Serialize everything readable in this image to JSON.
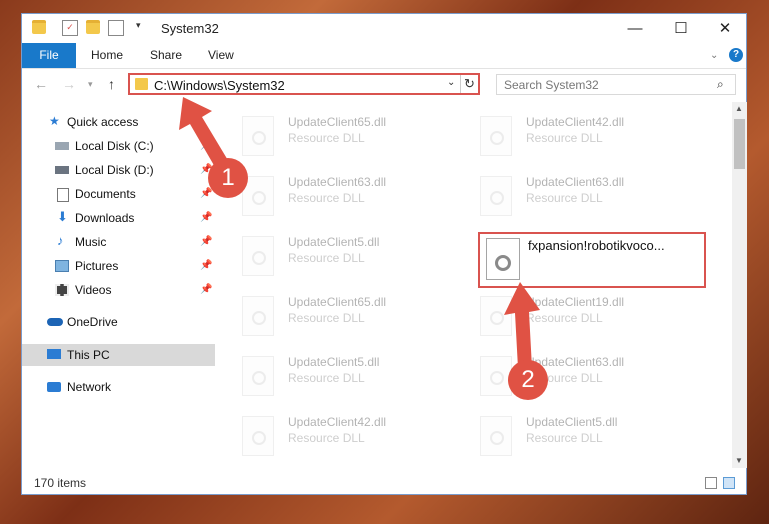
{
  "window": {
    "title": "System32"
  },
  "ribbon": {
    "file": "File",
    "tabs": [
      "Home",
      "Share",
      "View"
    ]
  },
  "address": {
    "path": "C:\\Windows\\System32",
    "search_placeholder": "Search System32"
  },
  "sidebar": {
    "items": [
      {
        "label": "Quick access",
        "icon": "star-icon"
      },
      {
        "label": "Local Disk (C:)",
        "icon": "drive-icon",
        "pinned": true
      },
      {
        "label": "Local Disk (D:)",
        "icon": "drive-icon",
        "pinned": true
      },
      {
        "label": "Documents",
        "icon": "documents-icon",
        "pinned": true
      },
      {
        "label": "Downloads",
        "icon": "downloads-icon",
        "pinned": true
      },
      {
        "label": "Music",
        "icon": "music-icon",
        "pinned": true
      },
      {
        "label": "Pictures",
        "icon": "pictures-icon",
        "pinned": true
      },
      {
        "label": "Videos",
        "icon": "videos-icon",
        "pinned": true
      },
      {
        "label": "OneDrive",
        "icon": "cloud-icon"
      },
      {
        "label": "This PC",
        "icon": "pc-icon",
        "selected": true
      },
      {
        "label": "Network",
        "icon": "network-icon"
      }
    ]
  },
  "files": [
    {
      "name": "UpdateClient65.dll",
      "type": "Resource DLL"
    },
    {
      "name": "UpdateClient42.dll",
      "type": "Resource DLL"
    },
    {
      "name": "UpdateClient63.dll",
      "type": "Resource DLL"
    },
    {
      "name": "UpdateClient63.dll",
      "type": "Resource DLL"
    },
    {
      "name": "UpdateClient5.dll",
      "type": "Resource DLL"
    },
    {
      "name": "fxpansion!robotikvoco...",
      "type": ""
    },
    {
      "name": "UpdateClient65.dll",
      "type": "Resource DLL"
    },
    {
      "name": "UpdateClient19.dll",
      "type": "Resource DLL"
    },
    {
      "name": "UpdateClient5.dll",
      "type": "Resource DLL"
    },
    {
      "name": "UpdateClient63.dll",
      "type": "Resource DLL"
    },
    {
      "name": "UpdateClient42.dll",
      "type": "Resource DLL"
    },
    {
      "name": "UpdateClient5.dll",
      "type": "Resource DLL"
    }
  ],
  "status": {
    "count": "170 items"
  },
  "annotations": {
    "one": "1",
    "two": "2"
  },
  "colors": {
    "accent": "#1979ca",
    "highlight": "#d9534f"
  }
}
